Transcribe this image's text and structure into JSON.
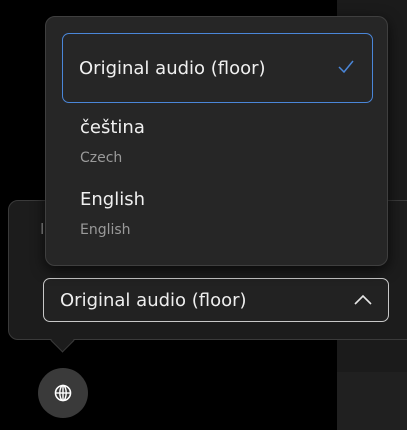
{
  "language_panel": {
    "label_stub": "I",
    "select": {
      "value": "Original audio (floor)",
      "expanded": true
    },
    "dropdown": {
      "options": [
        {
          "label": "Original audio (floor)",
          "sublabel": "",
          "selected": true
        },
        {
          "label": "čeština",
          "sublabel": "Czech",
          "selected": false
        },
        {
          "label": "English",
          "sublabel": "English",
          "selected": false
        }
      ]
    }
  },
  "controls": {
    "language_button_icon": "globe-icon"
  },
  "colors": {
    "accent": "#4a86d8",
    "background": "#000000",
    "panel": "#1c1c1c",
    "dropdown": "#262626"
  }
}
